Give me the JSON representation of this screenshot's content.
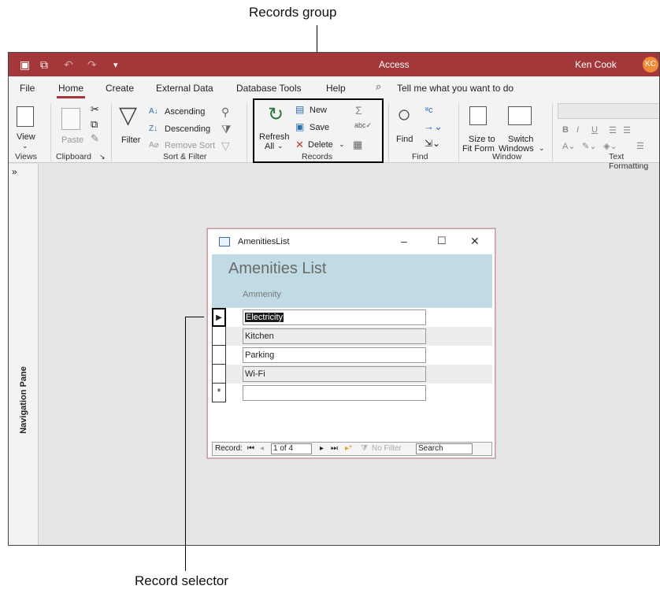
{
  "callouts": {
    "top": "Records group",
    "bottom": "Record selector"
  },
  "titlebar": {
    "title": "Access",
    "user": "Ken Cook",
    "initials": "KC"
  },
  "tabs": [
    "File",
    "Home",
    "Create",
    "External Data",
    "Database Tools",
    "Help"
  ],
  "tell_me": "Tell me what you want to do",
  "ribbon": {
    "views": {
      "label": "Views",
      "view": "View"
    },
    "clipboard": {
      "label": "Clipboard",
      "paste": "Paste"
    },
    "sort_filter": {
      "label": "Sort & Filter",
      "filter": "Filter",
      "ascending": "Ascending",
      "descending": "Descending",
      "remove_sort": "Remove Sort"
    },
    "records": {
      "label": "Records",
      "refresh": "Refresh",
      "all": "All",
      "new": "New",
      "save": "Save",
      "delete": "Delete"
    },
    "find": {
      "label": "Find",
      "find": "Find"
    },
    "window": {
      "label": "Window",
      "size_to": "Size to",
      "fit_form": "Fit Form",
      "switch": "Switch",
      "windows": "Windows"
    },
    "text_formatting": {
      "label": "Text Formatting"
    }
  },
  "nav_pane": {
    "label": "Navigation Pane"
  },
  "form": {
    "window_title": "AmenitiesList",
    "heading": "Amenities List",
    "column": "Ammenity",
    "rows": [
      "Electricity",
      "Kitchen",
      "Parking",
      "Wi-Fi"
    ],
    "status": {
      "record_label": "Record:",
      "position": "1 of 4",
      "filter": "No Filter",
      "search": "Search"
    }
  }
}
